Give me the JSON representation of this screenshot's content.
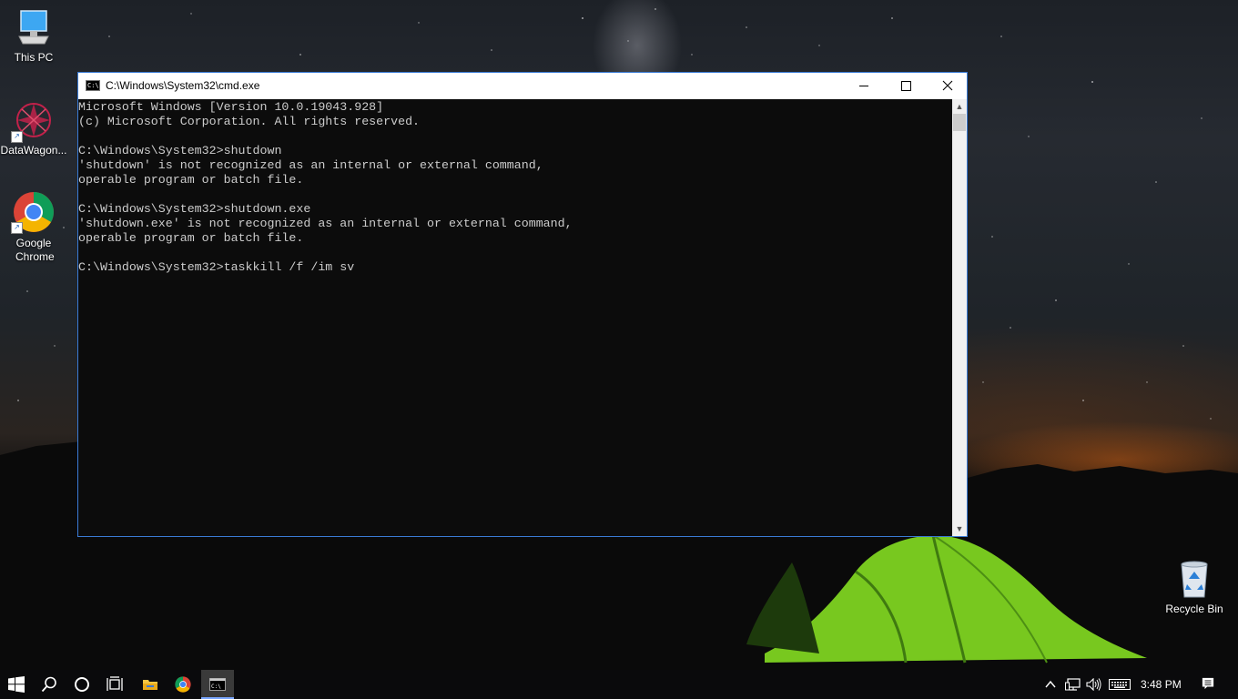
{
  "desktop": {
    "icons": [
      {
        "label": "This PC",
        "icon": "computer-icon"
      },
      {
        "label": "DataWagon...",
        "icon": "datawagon-icon"
      },
      {
        "label": "Google Chrome",
        "icon": "chrome-icon"
      },
      {
        "label": "Recycle Bin",
        "icon": "recycle-bin-icon"
      }
    ]
  },
  "window": {
    "title": "C:\\Windows\\System32\\cmd.exe",
    "console_lines": [
      "Microsoft Windows [Version 10.0.19043.928]",
      "(c) Microsoft Corporation. All rights reserved.",
      "",
      "C:\\Windows\\System32>shutdown",
      "'shutdown' is not recognized as an internal or external command,",
      "operable program or batch file.",
      "",
      "C:\\Windows\\System32>shutdown.exe",
      "'shutdown.exe' is not recognized as an internal or external command,",
      "operable program or batch file.",
      "",
      "C:\\Windows\\System32>taskkill /f /im sv"
    ]
  },
  "taskbar": {
    "items": [
      "start-icon",
      "search-icon",
      "cortana-icon",
      "task-view-icon",
      "file-explorer-icon",
      "chrome-icon",
      "cmd-icon"
    ],
    "active_item": "cmd-icon",
    "tray": [
      "chevron-up-icon",
      "network-icon",
      "volume-icon",
      "keyboard-icon"
    ],
    "clock": "3:48 PM",
    "notification_icon": "action-center-icon"
  },
  "colors": {
    "console_bg": "#0c0c0c",
    "console_text": "#cccccc",
    "taskbar_bg": "#0a0a0c",
    "tent_green": "#7ed321",
    "window_border": "#3a7bd5"
  }
}
